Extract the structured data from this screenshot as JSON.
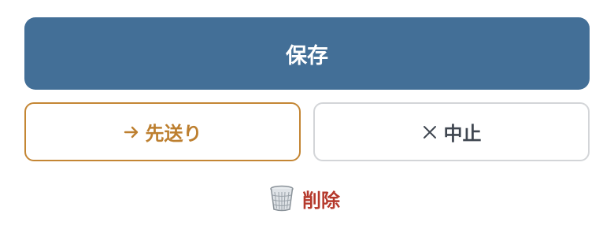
{
  "actions": {
    "save_label": "保存",
    "postpone_label": "先送り",
    "cancel_label": "中止",
    "delete_label": "削除"
  },
  "icons": {
    "postpone": "arrow-right-icon",
    "cancel": "close-icon",
    "delete": "wastebasket-icon"
  },
  "colors": {
    "primary": "#436f97",
    "postpone_accent": "#c48634",
    "cancel_border": "#d3d5d8",
    "cancel_text": "#3f4650",
    "danger": "#b5392c"
  }
}
